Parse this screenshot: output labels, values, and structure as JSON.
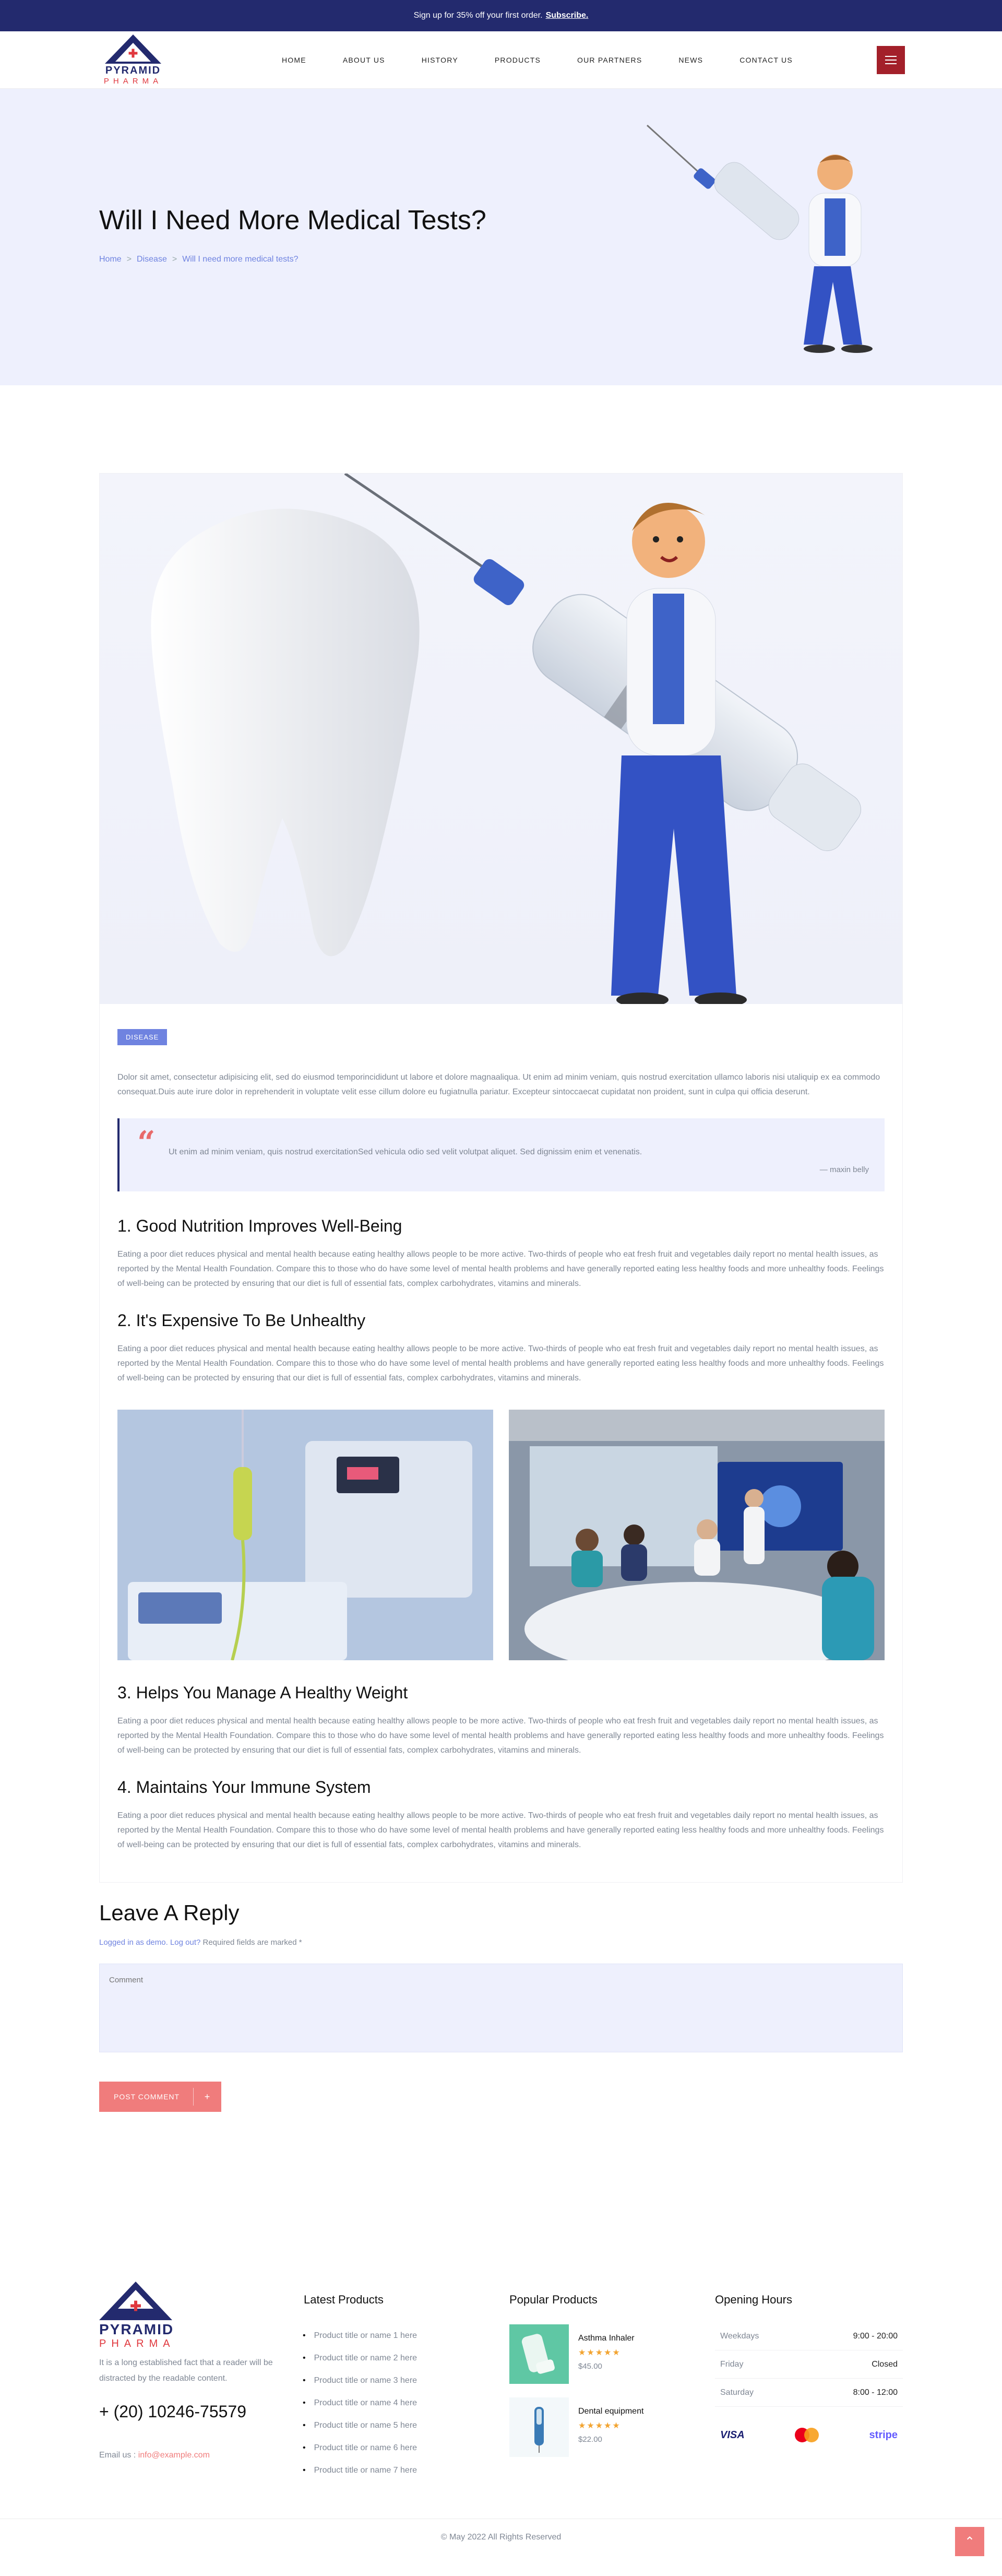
{
  "topbar": {
    "text": "Sign up for 35% off your first order.",
    "link": "Subscribe."
  },
  "brand": {
    "name": "PYRAMID",
    "sub": "PHARMA"
  },
  "nav": [
    "HOME",
    "ABOUT US",
    "HISTORY",
    "PRODUCTS",
    "OUR PARTNERS",
    "NEWS",
    "CONTACT US"
  ],
  "hero": {
    "title": "Will I Need More Medical Tests?",
    "breadcrumb": [
      "Home",
      "Disease",
      "Will I need more medical tests?"
    ]
  },
  "article": {
    "tag": "DISEASE",
    "intro": "Dolor sit amet, consectetur adipisicing elit, sed do eiusmod temporincididunt ut labore et dolore magnaaliqua. Ut enim ad minim veniam, quis nostrud exercitation ullamco laboris nisi utaliquip ex ea commodo consequat.Duis aute irure dolor in reprehenderit in voluptate velit esse cillum dolore eu fugiatnulla pariatur. Excepteur sintoccaecat cupidatat non proident, sunt in culpa qui officia deserunt.",
    "quote": "Ut enim ad minim veniam, quis nostrud exercitationSed vehicula odio sed velit volutpat aliquet. Sed dignissim enim et venenatis.",
    "quote_author": "— maxin belly",
    "sections": [
      {
        "heading": "1. Good Nutrition Improves Well-Being",
        "text": "Eating a poor diet reduces physical and mental health because eating healthy allows people to be more active. Two-thirds of people who eat fresh fruit and vegetables daily report no mental health issues, as reported by the Mental Health Foundation. Compare this to those who do have some level of mental health problems and have generally reported eating less healthy foods and more unhealthy foods. Feelings of well-being can be protected by ensuring that our diet is full of essential fats, complex carbohydrates, vitamins and minerals."
      },
      {
        "heading": "2. It's Expensive To Be Unhealthy",
        "text": "Eating a poor diet reduces physical and mental health because eating healthy allows people to be more active. Two-thirds of people who eat fresh fruit and vegetables daily report no mental health issues, as reported by the Mental Health Foundation. Compare this to those who do have some level of mental health problems and have generally reported eating less healthy foods and more unhealthy foods. Feelings of well-being can be protected by ensuring that our diet is full of essential fats, complex carbohydrates, vitamins and minerals."
      },
      {
        "heading": "3. Helps You Manage A Healthy Weight",
        "text": "Eating a poor diet reduces physical and mental health because eating healthy allows people to be more active. Two-thirds of people who eat fresh fruit and vegetables daily report no mental health issues, as reported by the Mental Health Foundation. Compare this to those who do have some level of mental health problems and have generally reported eating less healthy foods and more unhealthy foods. Feelings of well-being can be protected by ensuring that our diet is full of essential fats, complex carbohydrates, vitamins and minerals."
      },
      {
        "heading": "4. Maintains Your Immune System",
        "text": "Eating a poor diet reduces physical and mental health because eating healthy allows people to be more active. Two-thirds of people who eat fresh fruit and vegetables daily report no mental health issues, as reported by the Mental Health Foundation. Compare this to those who do have some level of mental health problems and have generally reported eating less healthy foods and more unhealthy foods. Feelings of well-being can be protected by ensuring that our diet is full of essential fats, complex carbohydrates, vitamins and minerals."
      }
    ]
  },
  "reply": {
    "title": "Leave A Reply",
    "logged_in": "Logged in as demo.",
    "logout": "Log out?",
    "required": "Required fields are marked *",
    "comment_placeholder": "Comment",
    "button": "POST COMMENT",
    "button_icon": "+"
  },
  "footer": {
    "about": "It is a long established fact that a reader will be distracted by the readable content.",
    "phone": "+ (20) 10246-75579",
    "email_label": "Email us :",
    "email": "info@example.com",
    "latest_title": "Latest Products",
    "latest": [
      "Product title or name 1 here",
      "Product title or name 2 here",
      "Product title or name 3 here",
      "Product title or name 4 here",
      "Product title or name 5 here",
      "Product title or name 6 here",
      "Product title or name 7 here"
    ],
    "popular_title": "Popular Products",
    "popular": [
      {
        "name": "Asthma Inhaler",
        "stars": "★★★★★",
        "price": "$45.00"
      },
      {
        "name": "Dental equipment",
        "stars": "★★★★★",
        "price": "$22.00"
      }
    ],
    "hours_title": "Opening Hours",
    "hours": [
      {
        "day": "Weekdays",
        "time": "9:00 - 20:00"
      },
      {
        "day": "Friday",
        "time": "Closed"
      },
      {
        "day": "Saturday",
        "time": "8:00 - 12:00"
      }
    ],
    "payments": [
      "VISA",
      "stripe"
    ],
    "copyright": "© May 2022 All Rights Reserved",
    "top_icon": "chevron-up-icon"
  },
  "colors": {
    "navy": "#232a6e",
    "accent": "#6f83e0",
    "coral": "#f07c7c",
    "hero_bg": "#eef0fd",
    "menu": "#a3202a"
  }
}
